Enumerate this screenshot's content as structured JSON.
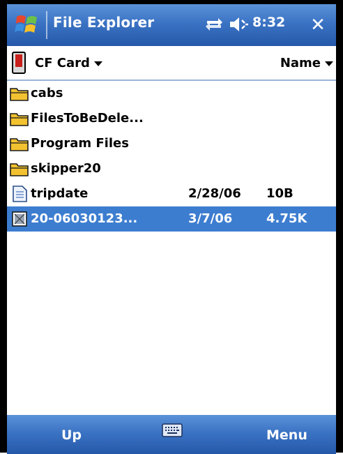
{
  "titlebar": {
    "title": "File Explorer",
    "time": "8:32",
    "close_label": "✕",
    "icons": [
      "windows-start-icon",
      "connectivity-icon",
      "volume-icon",
      "close-icon"
    ]
  },
  "pathbar": {
    "location": "CF Card",
    "sort": "Name",
    "icons": [
      "storage-card-icon",
      "chevron-down-icon"
    ]
  },
  "files": [
    {
      "name": "cabs",
      "type": "folder",
      "date": "",
      "size": "",
      "selected": false
    },
    {
      "name": "FilesToBeDele...",
      "type": "folder",
      "date": "",
      "size": "",
      "selected": false
    },
    {
      "name": "Program Files",
      "type": "folder",
      "date": "",
      "size": "",
      "selected": false
    },
    {
      "name": "skipper20",
      "type": "folder",
      "date": "",
      "size": "",
      "selected": false
    },
    {
      "name": "tripdate",
      "type": "document",
      "date": "2/28/06",
      "size": "10B",
      "selected": false
    },
    {
      "name": "20-06030123...",
      "type": "image",
      "date": "3/7/06",
      "size": "4.75K",
      "selected": true
    }
  ],
  "bottombar": {
    "left_softkey": "Up",
    "right_softkey": "Menu",
    "icons": [
      "keyboard-icon"
    ]
  },
  "colors": {
    "titlebar": "#3b73c4",
    "selection": "#3d7dd0",
    "folder": "#f2c230"
  }
}
